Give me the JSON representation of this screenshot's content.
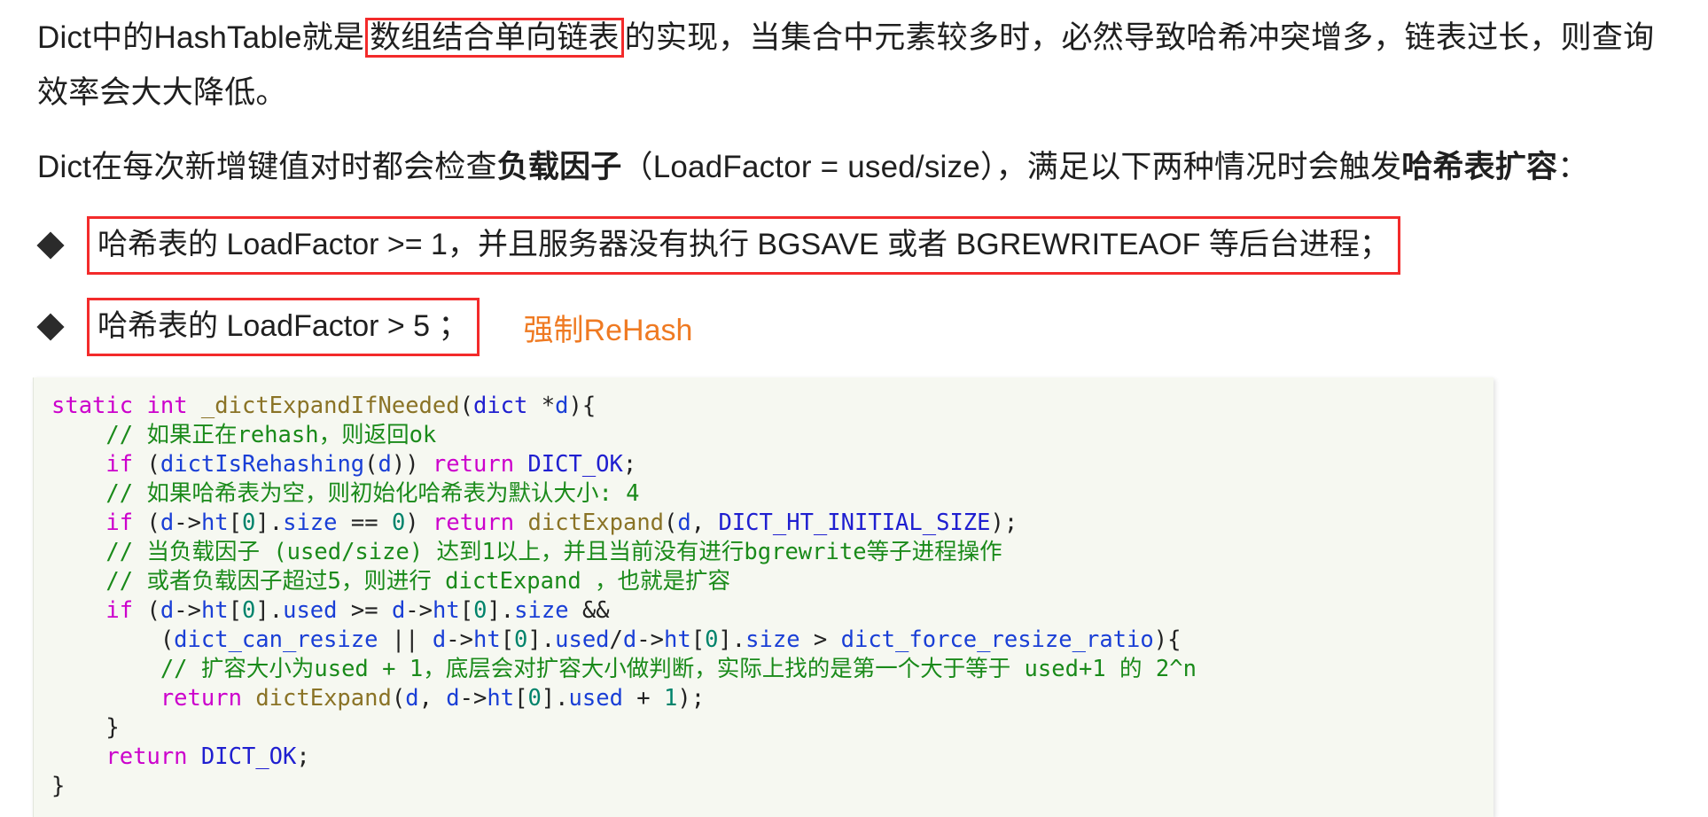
{
  "doc": {
    "paragraph1": {
      "before": "Dict中的HashTable就是",
      "highlight": "数组结合单向链表",
      "after": "的实现，当集合中元素较多时，必然导致哈希冲突增多，链表过长，则查询效率会大大降低。"
    },
    "paragraph2": {
      "before": "Dict在每次新增键值对时都会检查",
      "bold1": "负载因子",
      "middle": "（LoadFactor = used/size），满足以下两种情况时会触发",
      "bold2": "哈希表扩容",
      "after": "："
    },
    "bullets": [
      {
        "marker": "◆",
        "text": "哈希表的 LoadFactor >= 1，并且服务器没有执行 BGSAVE 或者 BGREWRITEAOF 等后台进程；",
        "note": ""
      },
      {
        "marker": "◆",
        "text": "哈希表的 LoadFactor > 5 ；",
        "note": "强制ReHash"
      }
    ],
    "code": {
      "language": "c",
      "lines": [
        [
          {
            "t": "static",
            "c": "kw"
          },
          {
            "t": " ",
            "c": "plain"
          },
          {
            "t": "int",
            "c": "kw"
          },
          {
            "t": " ",
            "c": "plain"
          },
          {
            "t": "_dictExpandIfNeeded",
            "c": "fn"
          },
          {
            "t": "(",
            "c": "plain"
          },
          {
            "t": "dict",
            "c": "type"
          },
          {
            "t": " *",
            "c": "plain"
          },
          {
            "t": "d",
            "c": "var"
          },
          {
            "t": "){",
            "c": "plain"
          }
        ],
        [
          {
            "t": "    // 如果正在rehash，则返回ok",
            "c": "cmt"
          }
        ],
        [
          {
            "t": "    ",
            "c": "plain"
          },
          {
            "t": "if",
            "c": "kw"
          },
          {
            "t": " (",
            "c": "plain"
          },
          {
            "t": "dictIsRehashing",
            "c": "var"
          },
          {
            "t": "(",
            "c": "plain"
          },
          {
            "t": "d",
            "c": "var"
          },
          {
            "t": ")) ",
            "c": "plain"
          },
          {
            "t": "return",
            "c": "kw"
          },
          {
            "t": " ",
            "c": "plain"
          },
          {
            "t": "DICT_OK",
            "c": "type"
          },
          {
            "t": ";",
            "c": "plain"
          }
        ],
        [
          {
            "t": "    // 如果哈希表为空，则初始化哈希表为默认大小: 4",
            "c": "cmt"
          }
        ],
        [
          {
            "t": "    ",
            "c": "plain"
          },
          {
            "t": "if",
            "c": "kw"
          },
          {
            "t": " (",
            "c": "plain"
          },
          {
            "t": "d",
            "c": "var"
          },
          {
            "t": "->",
            "c": "plain"
          },
          {
            "t": "ht",
            "c": "var"
          },
          {
            "t": "[",
            "c": "plain"
          },
          {
            "t": "0",
            "c": "num"
          },
          {
            "t": "].",
            "c": "plain"
          },
          {
            "t": "size",
            "c": "var"
          },
          {
            "t": " == ",
            "c": "plain"
          },
          {
            "t": "0",
            "c": "num"
          },
          {
            "t": ") ",
            "c": "plain"
          },
          {
            "t": "return",
            "c": "kw"
          },
          {
            "t": " ",
            "c": "plain"
          },
          {
            "t": "dictExpand",
            "c": "fn"
          },
          {
            "t": "(",
            "c": "plain"
          },
          {
            "t": "d",
            "c": "var"
          },
          {
            "t": ", ",
            "c": "plain"
          },
          {
            "t": "DICT_HT_INITIAL_SIZE",
            "c": "type"
          },
          {
            "t": ");",
            "c": "plain"
          }
        ],
        [
          {
            "t": "    // 当负载因子 (used/size) 达到1以上，并且当前没有进行bgrewrite等子进程操作",
            "c": "cmt"
          }
        ],
        [
          {
            "t": "    // 或者负载因子超过5，则进行 dictExpand ，也就是扩容",
            "c": "cmt"
          }
        ],
        [
          {
            "t": "    ",
            "c": "plain"
          },
          {
            "t": "if",
            "c": "kw"
          },
          {
            "t": " (",
            "c": "plain"
          },
          {
            "t": "d",
            "c": "var"
          },
          {
            "t": "->",
            "c": "plain"
          },
          {
            "t": "ht",
            "c": "var"
          },
          {
            "t": "[",
            "c": "plain"
          },
          {
            "t": "0",
            "c": "num"
          },
          {
            "t": "].",
            "c": "plain"
          },
          {
            "t": "used",
            "c": "var"
          },
          {
            "t": " >= ",
            "c": "plain"
          },
          {
            "t": "d",
            "c": "var"
          },
          {
            "t": "->",
            "c": "plain"
          },
          {
            "t": "ht",
            "c": "var"
          },
          {
            "t": "[",
            "c": "plain"
          },
          {
            "t": "0",
            "c": "num"
          },
          {
            "t": "].",
            "c": "plain"
          },
          {
            "t": "size",
            "c": "var"
          },
          {
            "t": " &&",
            "c": "plain"
          }
        ],
        [
          {
            "t": "        (",
            "c": "plain"
          },
          {
            "t": "dict_can_resize",
            "c": "var"
          },
          {
            "t": " || ",
            "c": "plain"
          },
          {
            "t": "d",
            "c": "var"
          },
          {
            "t": "->",
            "c": "plain"
          },
          {
            "t": "ht",
            "c": "var"
          },
          {
            "t": "[",
            "c": "plain"
          },
          {
            "t": "0",
            "c": "num"
          },
          {
            "t": "].",
            "c": "plain"
          },
          {
            "t": "used",
            "c": "var"
          },
          {
            "t": "/",
            "c": "plain"
          },
          {
            "t": "d",
            "c": "var"
          },
          {
            "t": "->",
            "c": "plain"
          },
          {
            "t": "ht",
            "c": "var"
          },
          {
            "t": "[",
            "c": "plain"
          },
          {
            "t": "0",
            "c": "num"
          },
          {
            "t": "].",
            "c": "plain"
          },
          {
            "t": "size",
            "c": "var"
          },
          {
            "t": " > ",
            "c": "plain"
          },
          {
            "t": "dict_force_resize_ratio",
            "c": "var"
          },
          {
            "t": "){",
            "c": "plain"
          }
        ],
        [
          {
            "t": "        // 扩容大小为used + 1，底层会对扩容大小做判断，实际上找的是第一个大于等于 used+1 的 2^n",
            "c": "cmt"
          }
        ],
        [
          {
            "t": "        ",
            "c": "plain"
          },
          {
            "t": "return",
            "c": "kw"
          },
          {
            "t": " ",
            "c": "plain"
          },
          {
            "t": "dictExpand",
            "c": "fn"
          },
          {
            "t": "(",
            "c": "plain"
          },
          {
            "t": "d",
            "c": "var"
          },
          {
            "t": ", ",
            "c": "plain"
          },
          {
            "t": "d",
            "c": "var"
          },
          {
            "t": "->",
            "c": "plain"
          },
          {
            "t": "ht",
            "c": "var"
          },
          {
            "t": "[",
            "c": "plain"
          },
          {
            "t": "0",
            "c": "num"
          },
          {
            "t": "].",
            "c": "plain"
          },
          {
            "t": "used",
            "c": "var"
          },
          {
            "t": " + ",
            "c": "plain"
          },
          {
            "t": "1",
            "c": "num"
          },
          {
            "t": ");",
            "c": "plain"
          }
        ],
        [
          {
            "t": "    }",
            "c": "plain"
          }
        ],
        [
          {
            "t": "    ",
            "c": "plain"
          },
          {
            "t": "return",
            "c": "kw"
          },
          {
            "t": " ",
            "c": "plain"
          },
          {
            "t": "DICT_OK",
            "c": "type"
          },
          {
            "t": ";",
            "c": "plain"
          }
        ],
        [
          {
            "t": "}",
            "c": "plain"
          }
        ]
      ]
    }
  },
  "colors": {
    "highlight_border": "#f32b2b",
    "note_text": "#ef7a22",
    "code_bg": "#f6f8f1",
    "keyword": "#cc00cc",
    "type": "#1f1fd0",
    "function": "#8a7326",
    "variable": "#1a3fd6",
    "number": "#00836b",
    "comment": "#1a8a1a"
  }
}
